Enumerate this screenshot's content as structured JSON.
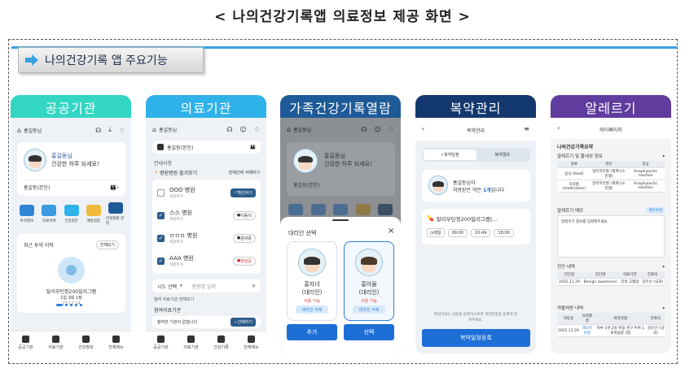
{
  "page_title": "< 나의건강기록앱 의료정보 제공 화면 >",
  "banner_label": "나의건강기록 앱 주요기능",
  "colors": {
    "tab1": "#32d6c3",
    "tab2": "#2fb2e9",
    "tab3": "#1e5a98",
    "tab4": "#12386e",
    "tab5": "#5f3c9e",
    "accent": "#2a7de1"
  },
  "p1": {
    "tab": "공공기관",
    "user": "홍길동님",
    "greet_name": "홍길동님",
    "greet_msg": "건강한 하루 되세요!",
    "self_label": "홍길동(본인)",
    "menu": [
      "투약정보",
      "진료이력",
      "건강검진",
      "예방접종",
      "만성질환 관리"
    ],
    "recent_title": "최근 투약 이력",
    "recent_more": "전체보기",
    "drug_name": "탈리부틴정200밀리그램",
    "drug_dose": "1일 3회 1정",
    "drug_date": "23.12.14",
    "nav": [
      "공공기관",
      "의료기관",
      "건강정보",
      "전체메뉴"
    ]
  },
  "p2": {
    "tab": "의료기관",
    "user": "홍길동님",
    "self_label": "홍길동(본인)",
    "notice": "안내사항",
    "fav_title": "병원병원 즐겨찾기",
    "fav_actions": "전체선택  삭제하기",
    "hospitals": [
      {
        "name": "OOO 병원",
        "sub": "처방추가",
        "tag": "확인하기",
        "checked": false
      },
      {
        "name": "스스 병원",
        "sub": "처방추가",
        "tag": "이동이",
        "checked": true
      },
      {
        "name": "ㅁㅁㅁ 병원",
        "sub": "처방추가",
        "tag": "준비중",
        "checked": true
      },
      {
        "name": "AAA 병원",
        "sub": "처방추가",
        "tag": "정검중",
        "checked": true
      }
    ],
    "search_select": "시도 선택",
    "search_placeholder": "병원명 입력",
    "consent_note": "참여 의료기관 전체보기",
    "joined_title": "참여의료기관",
    "joined_item": "참여한 기관이 없습니다",
    "joined_btn": "선택하기",
    "nav": [
      "공공기관",
      "의료기관",
      "건강기록",
      "전체메뉴"
    ]
  },
  "p3": {
    "tab": "가족건강기록열람",
    "user": "홍길동님",
    "greet_name": "홍길동님",
    "greet_msg": "건강한 하루 되세요!",
    "self_label": "홍길동(본인)",
    "sheet_title": "대리인 선택",
    "people": [
      {
        "name": "홍자녀",
        "role": "(대리인)",
        "status": "사용 가능",
        "action": "대리인 삭제"
      },
      {
        "name": "홍아들",
        "role": "(대리인)",
        "status": "사용 가능",
        "action": "대리인 삭제"
      }
    ],
    "add_btn": "추가",
    "select_btn": "선택"
  },
  "p4": {
    "tab": "복약관리",
    "header": "복약관리",
    "seg": [
      "복약일정",
      "복약결과"
    ],
    "user_line1": "홍길동님이",
    "user_line2_a": "처방받은 약은",
    "user_line2_b": "1개",
    "user_line2_c": "입니다",
    "drug": "탈리부틴정200밀리그램(...",
    "times_label": "매일",
    "times": [
      "09:00",
      "10:49",
      "18:00"
    ],
    "note": "복약안내는 내용을 등록하시려면 복약일정을 등록해 알려주세요.",
    "register_btn": "복약일정등록"
  },
  "p5": {
    "tab": "알레르기",
    "header": "마이페이지",
    "section_title": "나의건강기록요약",
    "allergy_title": "알레르기 및 불내성 정보",
    "allergy_cols": [
      "종류",
      "원인",
      "증상"
    ],
    "allergy_rows": [
      [
        "음식 (food)",
        "알러지유발 (계피나소진행)",
        "Anaphylactic reaction"
      ],
      [
        "의약품 (medication)",
        "알러지유발 (계피나소진행)",
        "Anaphylactic reaction"
      ]
    ],
    "memo_title": "알레르기 메모",
    "memo_edit": "메모수정",
    "memo_text": "알레르기 정보를 입력해주세요.",
    "diag_title": "진단 내역",
    "diag_cols": [
      "진단일",
      "진단명",
      "의료기관",
      "진료의"
    ],
    "diag_row": [
      "2022.11.29",
      "Benign awareness",
      "양성 고혈압",
      "김유선 (내과)"
    ],
    "rx_title": "약물처방 내역",
    "rx_cols": [
      "처방일",
      "의약품명",
      "복약방법",
      "진료의"
    ],
    "rx_row": [
      "2022.11.29",
      "레오파린정",
      "하루 1번 2일 복용 경구 투여 1회복용량 2정",
      "김유선 (내과)"
    ]
  }
}
